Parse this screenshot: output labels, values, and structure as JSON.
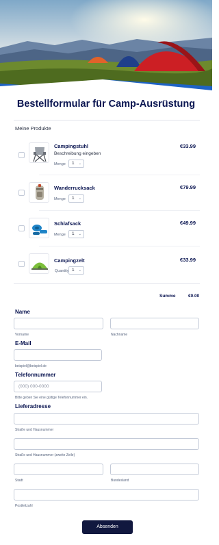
{
  "form": {
    "title": "Bestellformular für Camp-Ausrüstung",
    "products_label": "Meine Produkte"
  },
  "products": [
    {
      "name": "Campingstuhl",
      "description": "Beschreibung eingeben",
      "price": "€33.99",
      "qty_label": "Menge",
      "qty": "1",
      "image": "camping-chair-icon"
    },
    {
      "name": "Wanderrucksack",
      "price": "€79.99",
      "qty_label": "Menge",
      "qty": "1",
      "image": "backpack-icon"
    },
    {
      "name": "Schlafsack",
      "price": "€49.99",
      "qty_label": "Menge",
      "qty": "1",
      "image": "sleeping-bag-icon"
    },
    {
      "name": "Campingzelt",
      "price": "€33.99",
      "qty_label": "Quantity",
      "qty": "1",
      "image": "tent-icon"
    }
  ],
  "total": {
    "label": "Summe",
    "value": "€0.00"
  },
  "fields": {
    "name": {
      "label": "Name",
      "first_sub": "Vorname",
      "last_sub": "Nachname"
    },
    "email": {
      "label": "E-Mail",
      "sub": "beispiel@beispiel.de"
    },
    "phone": {
      "label": "Telefonnummer",
      "placeholder": "(000) 000-0000",
      "sub": "Bitte geben Sie eine gültige Telefonnummer ein."
    },
    "address": {
      "label": "Lieferadresse",
      "street_sub": "Straße und Hausnummer",
      "street2_sub": "Straße und Hausnummer (zweite Zeile)",
      "city_sub": "Stadt",
      "state_sub": "Bundesland",
      "zip_sub": "Postleitzahl"
    }
  },
  "submit_label": "Absenden",
  "colors": {
    "primary": "#0a1551",
    "button": "#11183f",
    "hero_accent": "#1e63c6"
  }
}
